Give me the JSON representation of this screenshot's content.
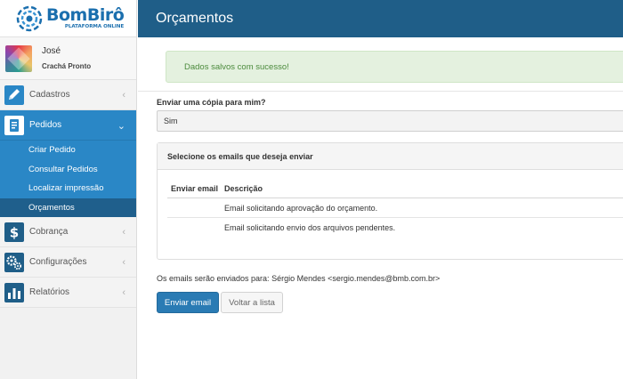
{
  "brand": {
    "title": "BomBirô",
    "subtitle": "PLATAFORMA ONLINE",
    "color": "#1b6fae"
  },
  "user": {
    "name": "José",
    "role": "Crachá Pronto"
  },
  "sidebar": {
    "items": [
      {
        "label": "Cadastros",
        "icon": "pencil-icon"
      },
      {
        "label": "Pedidos",
        "icon": "clipboard-icon",
        "expanded": true
      },
      {
        "label": "Cobrança",
        "icon": "dollar-icon"
      },
      {
        "label": "Configurações",
        "icon": "gears-icon"
      },
      {
        "label": "Relatórios",
        "icon": "bar-chart-icon"
      }
    ],
    "submenu": [
      "Criar Pedido",
      "Consultar Pedidos",
      "Localizar impressão",
      "Orçamentos"
    ],
    "active_submenu": "Orçamentos",
    "accent": "#2a87c6"
  },
  "header": {
    "title": "Orçamentos",
    "color": "#1f5e88"
  },
  "alert": {
    "message": "Dados salvos com sucesso!"
  },
  "form": {
    "copy_label": "Enviar uma cópia para mim?",
    "copy_value": "Sim"
  },
  "emails_panel": {
    "title": "Selecione os emails que deseja enviar",
    "columns": [
      "Enviar email",
      "Descrição"
    ],
    "rows": [
      {
        "checked": true,
        "description": "Email solicitando aprovação do orçamento."
      },
      {
        "checked": true,
        "description": "Email solicitando envio dos arquivos pendentes."
      }
    ]
  },
  "recipients_text": "Os emails serão enviados para: Sérgio Mendes <sergio.mendes@bmb.com.br>",
  "buttons": {
    "send": "Enviar email",
    "back": "Voltar a lista"
  }
}
